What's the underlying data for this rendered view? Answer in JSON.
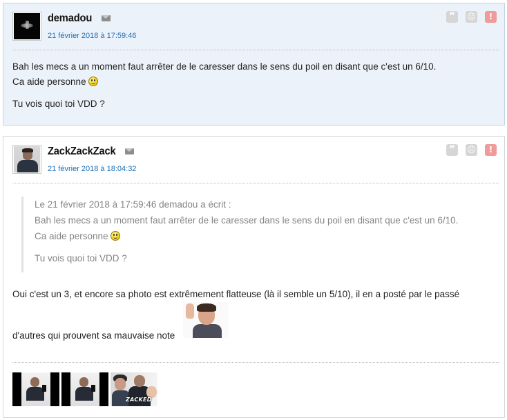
{
  "posts": [
    {
      "username": "demadou",
      "date": "21 février 2018 à 17:59:46",
      "lines": [
        "Bah les mecs a un moment faut arrêter de le caresser dans le sens du poil en disant que c'est un 6/10.",
        "Ca aide personne",
        "Tu vois quoi toi VDD ?"
      ]
    },
    {
      "username": "ZackZackZack",
      "date": "21 février 2018 à 18:04:32",
      "quote": {
        "header": "Le 21 février 2018 à 17:59:46 demadou a écrit :",
        "lines": [
          "Bah les mecs a un moment faut arrêter de le caresser dans le sens du poil en disant que c'est un 6/10.",
          "Ca aide personne",
          "Tu vois quoi toi VDD ?"
        ]
      },
      "lines": [
        "Oui c'est un 3, et encore sa photo est extrêmement flatteuse (là il semble un 5/10), il en a posté par le passé",
        "d'autres qui prouvent sa mauvaise note"
      ],
      "thumbnail_caption": "ZACKED"
    }
  ],
  "actions": {
    "quote_glyph": "”",
    "mp_glyph": "☹",
    "alert_glyph": "!"
  },
  "colors": {
    "post1_bg": "#ecf2f9",
    "date_link": "#1d6fb5",
    "alert": "#f09a9a"
  }
}
